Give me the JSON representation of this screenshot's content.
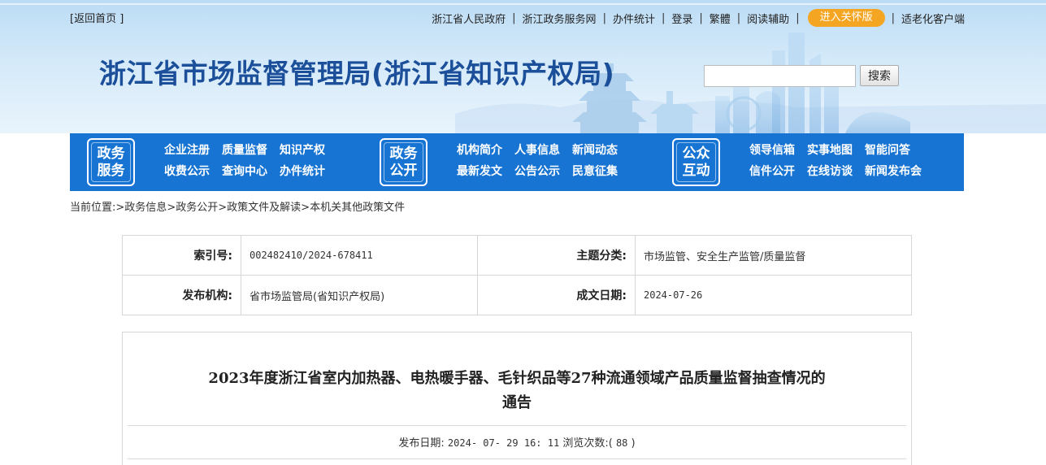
{
  "header": {
    "back_home": "[返回首页 ]",
    "top_links": [
      "浙江省人民政府",
      "浙江政务服务网",
      "办件统计",
      "登录",
      "繁體",
      "阅读辅助"
    ],
    "care_mode": "进入关怀版",
    "elderly_client": "适老化客户端",
    "site_title": "浙江省市场监督管理局(浙江省知识产权局)",
    "search_placeholder": "",
    "search_button": "搜索"
  },
  "mainnav": {
    "groups": [
      {
        "badge_line1": "政务",
        "badge_line2": "服务",
        "links": [
          "企业注册",
          "质量监督",
          "知识产权",
          "收费公示",
          "查询中心",
          "办件统计"
        ]
      },
      {
        "badge_line1": "政务",
        "badge_line2": "公开",
        "links": [
          "机构简介",
          "人事信息",
          "新闻动态",
          "最新发文",
          "公告公示",
          "民意征集"
        ]
      },
      {
        "badge_line1": "公众",
        "badge_line2": "互动",
        "links": [
          "领导信箱",
          "实事地图",
          "智能问答",
          "信件公开",
          "在线访谈",
          "新闻发布会"
        ]
      }
    ]
  },
  "breadcrumb": {
    "prefix": "当前位置:",
    "items": [
      "政务信息",
      "政务公开",
      "政策文件及解读",
      "本机关其他政策文件"
    ]
  },
  "info": {
    "index_label": "索引号:",
    "index_value": "002482410/2024-678411",
    "topic_label": "主题分类:",
    "topic_value": "市场监管、安全生产监管/质量监督",
    "publisher_label": "发布机构:",
    "publisher_value": "省市场监管局(省知识产权局)",
    "date_label": "成文日期:",
    "date_value": "2024-07-26"
  },
  "article": {
    "title": "2023年度浙江省室内加热器、电热暖手器、毛针织品等27种流通领域产品质量监督抽查情况的通告",
    "publish_label": "发布日期:",
    "publish_value": "2024- 07- 29 16: 11",
    "views_label": "浏览次数:(",
    "views_value": "88",
    "views_suffix": ")"
  },
  "colors": {
    "nav_blue": "#1774d2",
    "title_blue": "#1b4f9a",
    "care_orange": "#f4a522"
  }
}
